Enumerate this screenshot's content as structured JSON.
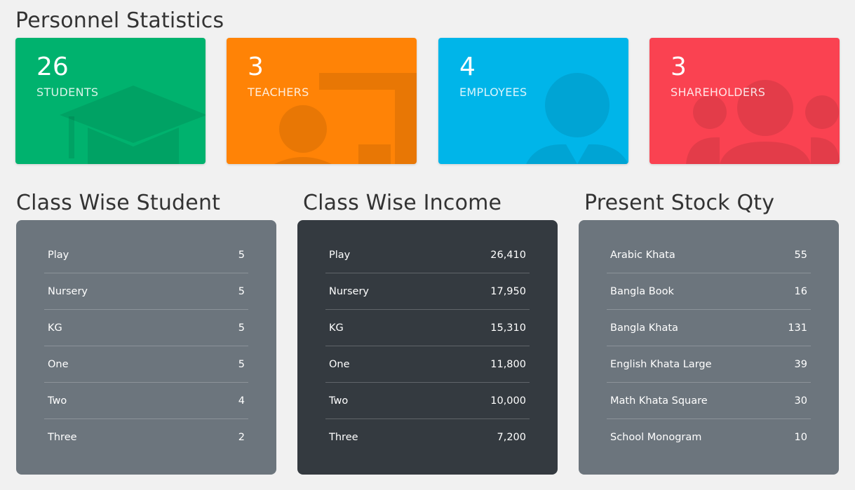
{
  "personnel": {
    "title": "Personnel Statistics",
    "cards": [
      {
        "count": "26",
        "label": "STUDENTS",
        "icon": "graduation-cap-icon",
        "color": "#00b26e"
      },
      {
        "count": "3",
        "label": "TEACHERS",
        "icon": "teacher-board-icon",
        "color": "#ff8306"
      },
      {
        "count": "4",
        "label": "EMPLOYEES",
        "icon": "employee-icon",
        "color": "#00b5e9"
      },
      {
        "count": "3",
        "label": "SHAREHOLDERS",
        "icon": "users-group-icon",
        "color": "#fa4251"
      }
    ]
  },
  "class_student": {
    "title": "Class Wise Student",
    "color": "#6c757d",
    "rows": [
      {
        "name": "Play",
        "value": "5"
      },
      {
        "name": "Nursery",
        "value": "5"
      },
      {
        "name": "KG",
        "value": "5"
      },
      {
        "name": "One",
        "value": "5"
      },
      {
        "name": "Two",
        "value": "4"
      },
      {
        "name": "Three",
        "value": "2"
      }
    ]
  },
  "class_income": {
    "title": "Class Wise Income",
    "color": "#343a40",
    "rows": [
      {
        "name": "Play",
        "value": "26,410"
      },
      {
        "name": "Nursery",
        "value": "17,950"
      },
      {
        "name": "KG",
        "value": "15,310"
      },
      {
        "name": "One",
        "value": "11,800"
      },
      {
        "name": "Two",
        "value": "10,000"
      },
      {
        "name": "Three",
        "value": "7,200"
      }
    ]
  },
  "stock": {
    "title": "Present Stock Qty",
    "color": "#6c757d",
    "rows": [
      {
        "name": "Arabic Khata",
        "value": "55"
      },
      {
        "name": "Bangla Book",
        "value": "16"
      },
      {
        "name": "Bangla Khata",
        "value": "131"
      },
      {
        "name": "English Khata Large",
        "value": "39"
      },
      {
        "name": "Math Khata Square",
        "value": "30"
      },
      {
        "name": "School Monogram",
        "value": "10"
      }
    ]
  }
}
